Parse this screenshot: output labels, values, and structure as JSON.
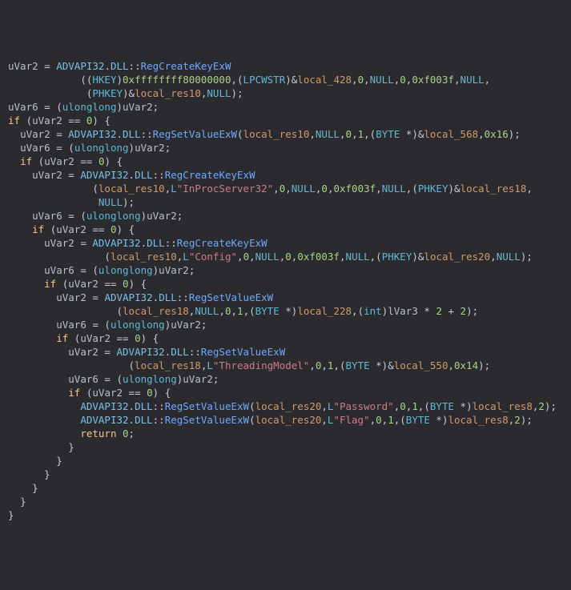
{
  "functions": {
    "RegCreateKeyExW": "RegCreateKeyExW",
    "RegSetValueExW": "RegSetValueExW"
  },
  "ns": {
    "advapi": "ADVAPI32",
    "dll": "DLL"
  },
  "types": {
    "HKEY": "HKEY",
    "LPCWSTR": "LPCWSTR",
    "BYTE": "BYTE",
    "PHKEY": "PHKEY",
    "ulonglong": "ulonglong",
    "int_t": "int"
  },
  "kw": {
    "if_": "if",
    "return_": "return"
  },
  "vars": {
    "uVar2": "uVar2",
    "uVar6": "uVar6",
    "lVar3": "lVar3"
  },
  "locals": {
    "l428": "local_428",
    "l568": "local_568",
    "l228": "local_228",
    "l550": "local_550",
    "lres10": "local_res10",
    "lres18": "local_res18",
    "lres20": "local_res20",
    "lres8": "local_res8"
  },
  "lits": {
    "NULL": "NULL",
    "L": "L"
  },
  "strs": {
    "inproc": "\"InProcServer32\"",
    "config": "\"Config\"",
    "threading": "\"ThreadingModel\"",
    "password": "\"Password\"",
    "flag": "\"Flag\""
  },
  "nums": {
    "n0": "0",
    "n1": "1",
    "n2": "2",
    "h16": "0x16",
    "hf003f": "0xf003f",
    "hbig": "0xffffffff80000000",
    "h14": "0x14"
  }
}
